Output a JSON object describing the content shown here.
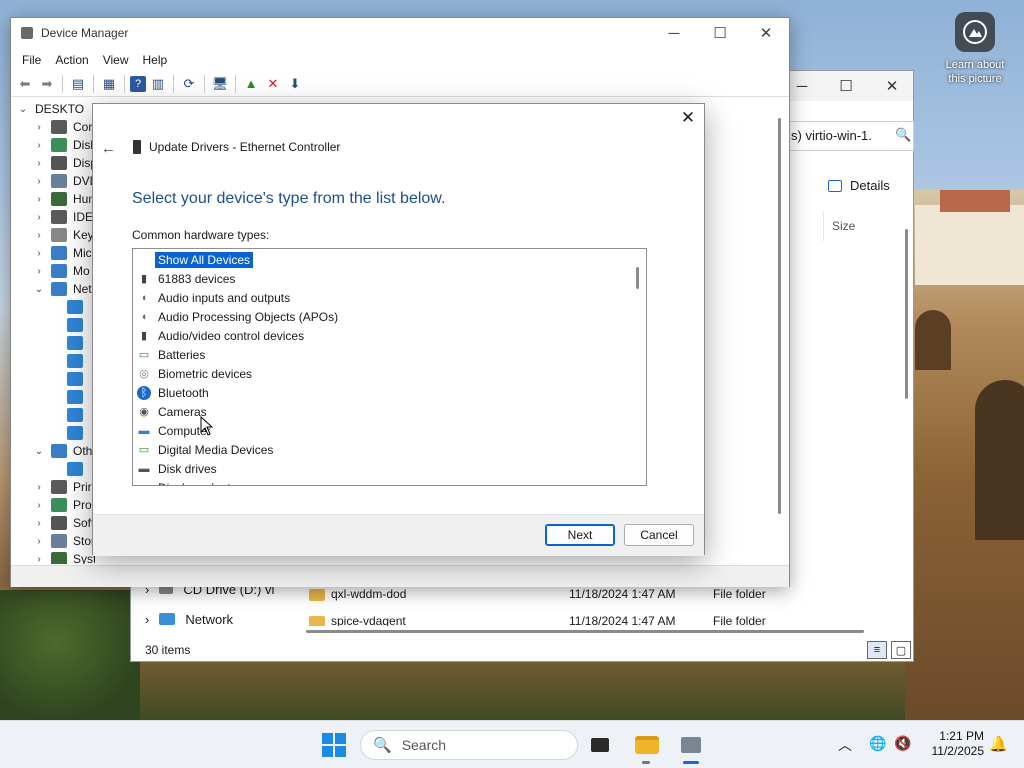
{
  "desktop": {
    "learn_about_line1": "Learn about",
    "learn_about_line2": "this picture"
  },
  "explorer": {
    "address_text": "s) virtio-win-1.",
    "details_label": "Details",
    "size_header": "Size",
    "nav_items": [
      "CD Drive (D:) vi",
      "Network"
    ],
    "rows": [
      {
        "name": "qxl-wddm-dod",
        "date": "11/18/2024 1:47 AM",
        "type": "File folder"
      },
      {
        "name": "spice-vdagent",
        "date": "11/18/2024 1:47 AM",
        "type": "File folder"
      }
    ],
    "status": "30 items"
  },
  "device_manager": {
    "title": "Device Manager",
    "menu": [
      "File",
      "Action",
      "View",
      "Help"
    ],
    "tree": [
      {
        "label": "DESKTO",
        "chev": "v",
        "indent": 0
      },
      {
        "label": "Cor",
        "chev": ">",
        "indent": 1
      },
      {
        "label": "Disk",
        "chev": ">",
        "indent": 1
      },
      {
        "label": "Disp",
        "chev": ">",
        "indent": 1
      },
      {
        "label": "DVD",
        "chev": ">",
        "indent": 1
      },
      {
        "label": "Hum",
        "chev": ">",
        "indent": 1
      },
      {
        "label": "IDE",
        "chev": ">",
        "indent": 1
      },
      {
        "label": "Key",
        "chev": ">",
        "indent": 1
      },
      {
        "label": "Mic",
        "chev": ">",
        "indent": 1
      },
      {
        "label": "Mo",
        "chev": ">",
        "indent": 1
      },
      {
        "label": "Net",
        "chev": "v",
        "indent": 1
      },
      {
        "label": "",
        "chev": "",
        "indent": 2
      },
      {
        "label": "",
        "chev": "",
        "indent": 2
      },
      {
        "label": "",
        "chev": "",
        "indent": 2
      },
      {
        "label": "",
        "chev": "",
        "indent": 2
      },
      {
        "label": "",
        "chev": "",
        "indent": 2
      },
      {
        "label": "",
        "chev": "",
        "indent": 2
      },
      {
        "label": "",
        "chev": "",
        "indent": 2
      },
      {
        "label": "",
        "chev": "",
        "indent": 2
      },
      {
        "label": "Oth",
        "chev": "v",
        "indent": 1
      },
      {
        "label": "",
        "chev": "",
        "indent": 2
      },
      {
        "label": "Prir",
        "chev": ">",
        "indent": 1
      },
      {
        "label": "Pro",
        "chev": ">",
        "indent": 1
      },
      {
        "label": "Soft",
        "chev": ">",
        "indent": 1
      },
      {
        "label": "Stor",
        "chev": ">",
        "indent": 1
      },
      {
        "label": "System devices",
        "chev": ">",
        "indent": 1
      }
    ]
  },
  "dialog": {
    "header": "Update Drivers - Ethernet Controller",
    "heading": "Select your device's type from the list below.",
    "list_label": "Common hardware types:",
    "items": [
      {
        "label": "Show All Devices",
        "icon": "none",
        "selected": true
      },
      {
        "label": "61883 devices",
        "icon": "usb-plug-icon",
        "selected": false
      },
      {
        "label": "Audio inputs and outputs",
        "icon": "speaker-icon",
        "selected": false
      },
      {
        "label": "Audio Processing Objects (APOs)",
        "icon": "speaker-icon",
        "selected": false
      },
      {
        "label": "Audio/video control devices",
        "icon": "usb-plug-icon",
        "selected": false
      },
      {
        "label": "Batteries",
        "icon": "battery-icon",
        "selected": false
      },
      {
        "label": "Biometric devices",
        "icon": "fingerprint-icon",
        "selected": false
      },
      {
        "label": "Bluetooth",
        "icon": "bluetooth-icon",
        "selected": false
      },
      {
        "label": "Cameras",
        "icon": "camera-icon",
        "selected": false
      },
      {
        "label": "Computer",
        "icon": "computer-icon",
        "selected": false
      },
      {
        "label": "Digital Media Devices",
        "icon": "media-device-icon",
        "selected": false
      },
      {
        "label": "Disk drives",
        "icon": "disk-drive-icon",
        "selected": false
      },
      {
        "label": "Display adapters",
        "icon": "display-icon",
        "selected": false
      }
    ],
    "next_label": "Next",
    "cancel_label": "Cancel"
  },
  "taskbar": {
    "search_placeholder": "Search",
    "time": "1:21 PM",
    "date": "11/2/2025"
  },
  "colors": {
    "accent": "#0a64d0",
    "heading": "#1e4f8a",
    "taskbar_bg": "#eef1f5"
  }
}
